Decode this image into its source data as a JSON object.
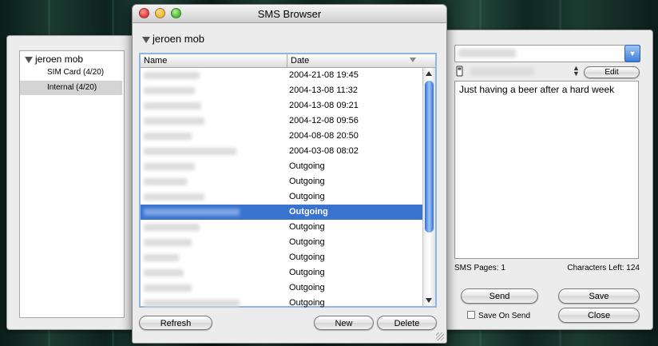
{
  "window": {
    "title": "SMS Browser",
    "group_label": "jeroen mob"
  },
  "table": {
    "columns": [
      "Name",
      "Date"
    ],
    "rows": [
      {
        "date": "2004-21-08 19:45",
        "selected": false
      },
      {
        "date": "2004-13-08 11:32",
        "selected": false
      },
      {
        "date": "2004-13-08 09:21",
        "selected": false
      },
      {
        "date": "2004-12-08 09:56",
        "selected": false
      },
      {
        "date": "2004-08-08 20:50",
        "selected": false
      },
      {
        "date": "2004-03-08 08:02",
        "selected": false
      },
      {
        "date": "Outgoing",
        "selected": false
      },
      {
        "date": "Outgoing",
        "selected": false
      },
      {
        "date": "Outgoing",
        "selected": false
      },
      {
        "date": "Outgoing",
        "selected": true
      },
      {
        "date": "Outgoing",
        "selected": false
      },
      {
        "date": "Outgoing",
        "selected": false
      },
      {
        "date": "Outgoing",
        "selected": false
      },
      {
        "date": "Outgoing",
        "selected": false
      },
      {
        "date": "Outgoing",
        "selected": false
      },
      {
        "date": "Outgoing",
        "selected": false
      }
    ]
  },
  "buttons": {
    "refresh": "Refresh",
    "new": "New",
    "delete": "Delete",
    "edit": "Edit",
    "send": "Send",
    "save": "Save",
    "close": "Close"
  },
  "left_drawer": {
    "root_label": "jeroen mob",
    "items": [
      {
        "label": "SIM Card (4/20)",
        "selected": false
      },
      {
        "label": "Internal (4/20)",
        "selected": true
      }
    ]
  },
  "right_drawer": {
    "message": "Just having a beer after a hard week",
    "sms_pages": "SMS Pages: 1",
    "chars_left": "Characters Left: 124",
    "save_on_send": "Save On Send"
  },
  "colors": {
    "selection": "#3a73cf",
    "focus_ring": "#8fb5e6",
    "close_light": "#e0443e",
    "minimize_light": "#f4b63b",
    "zoom_light": "#4fbf3a"
  },
  "icons": [
    "close-icon",
    "minimize-icon",
    "zoom-icon",
    "disclosure-triangle-icon",
    "phone-icon",
    "combo-arrow-icon",
    "stepper-icon",
    "sort-arrow-icon",
    "grow-box-icon"
  ]
}
